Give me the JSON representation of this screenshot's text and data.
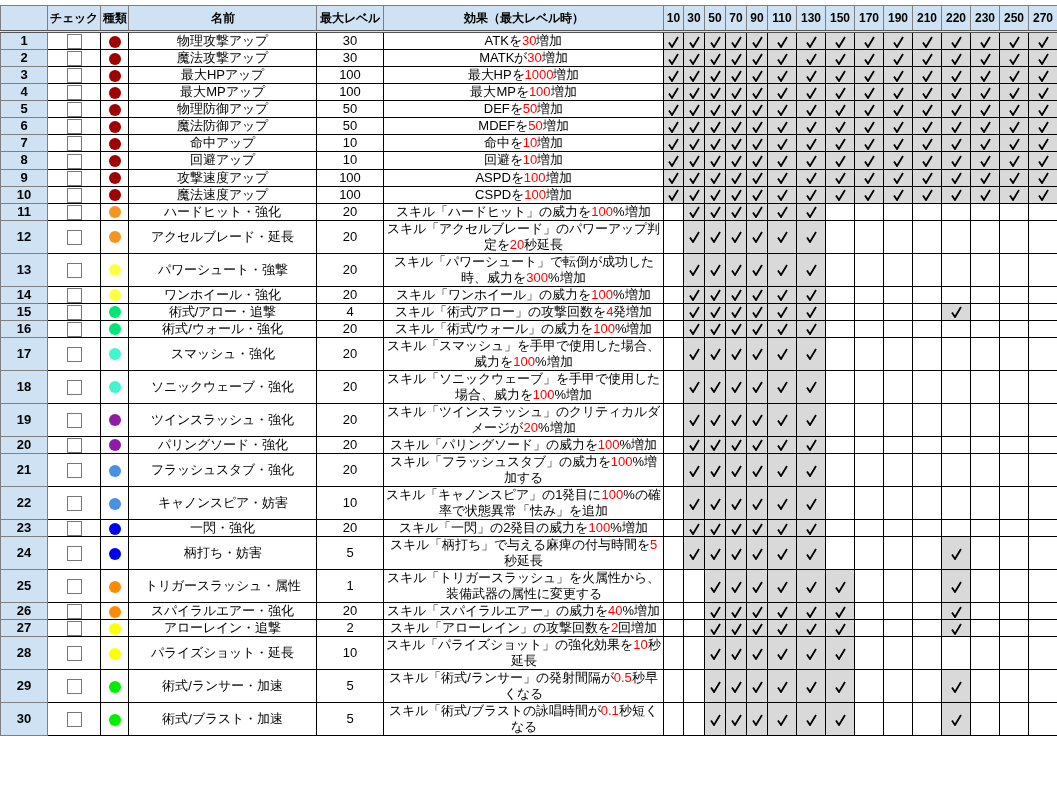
{
  "columns": [
    "チェック",
    "種類",
    "名前",
    "最大レベル",
    "効果（最大レベル時）"
  ],
  "level_columns": [
    "10",
    "30",
    "50",
    "70",
    "90",
    "110",
    "130",
    "150",
    "170",
    "190",
    "210",
    "220",
    "230",
    "250",
    "270"
  ],
  "rows": [
    {
      "no": "1",
      "checked": false,
      "color": "#a00000",
      "name": "物理攻撃アップ",
      "max_level": "30",
      "effect": [
        {
          "text": "ATKを"
        },
        {
          "text": "30",
          "emphasis": true
        },
        {
          "text": "増加"
        }
      ],
      "levels": [
        true,
        true,
        true,
        true,
        true,
        true,
        true,
        true,
        true,
        true,
        true,
        true,
        true,
        true,
        true
      ]
    },
    {
      "no": "2",
      "checked": false,
      "color": "#a00000",
      "name": "魔法攻撃アップ",
      "max_level": "30",
      "effect": [
        {
          "text": "MATKが"
        },
        {
          "text": "30",
          "emphasis": true
        },
        {
          "text": "増加"
        }
      ],
      "levels": [
        true,
        true,
        true,
        true,
        true,
        true,
        true,
        true,
        true,
        true,
        true,
        true,
        true,
        true,
        true
      ]
    },
    {
      "no": "3",
      "checked": false,
      "color": "#a00000",
      "name": "最大HPアップ",
      "max_level": "100",
      "effect": [
        {
          "text": "最大HPを"
        },
        {
          "text": "1000",
          "emphasis": true
        },
        {
          "text": "増加"
        }
      ],
      "levels": [
        true,
        true,
        true,
        true,
        true,
        true,
        true,
        true,
        true,
        true,
        true,
        true,
        true,
        true,
        true
      ]
    },
    {
      "no": "4",
      "checked": false,
      "color": "#a00000",
      "name": "最大MPアップ",
      "max_level": "100",
      "effect": [
        {
          "text": "最大MPを"
        },
        {
          "text": "100",
          "emphasis": true
        },
        {
          "text": "増加"
        }
      ],
      "levels": [
        true,
        true,
        true,
        true,
        true,
        true,
        true,
        true,
        true,
        true,
        true,
        true,
        true,
        true,
        true
      ]
    },
    {
      "no": "5",
      "checked": false,
      "color": "#a00000",
      "name": "物理防御アップ",
      "max_level": "50",
      "effect": [
        {
          "text": "DEFを"
        },
        {
          "text": "50",
          "emphasis": true
        },
        {
          "text": "増加"
        }
      ],
      "levels": [
        true,
        true,
        true,
        true,
        true,
        true,
        true,
        true,
        true,
        true,
        true,
        true,
        true,
        true,
        true
      ]
    },
    {
      "no": "6",
      "checked": false,
      "color": "#a00000",
      "name": "魔法防御アップ",
      "max_level": "50",
      "effect": [
        {
          "text": "MDEFを"
        },
        {
          "text": "50",
          "emphasis": true
        },
        {
          "text": "増加"
        }
      ],
      "levels": [
        true,
        true,
        true,
        true,
        true,
        true,
        true,
        true,
        true,
        true,
        true,
        true,
        true,
        true,
        true
      ]
    },
    {
      "no": "7",
      "checked": false,
      "color": "#a00000",
      "name": "命中アップ",
      "max_level": "10",
      "effect": [
        {
          "text": "命中を"
        },
        {
          "text": "10",
          "emphasis": true
        },
        {
          "text": "増加"
        }
      ],
      "levels": [
        true,
        true,
        true,
        true,
        true,
        true,
        true,
        true,
        true,
        true,
        true,
        true,
        true,
        true,
        true
      ]
    },
    {
      "no": "8",
      "checked": false,
      "color": "#a00000",
      "name": "回避アップ",
      "max_level": "10",
      "effect": [
        {
          "text": "回避を"
        },
        {
          "text": "10",
          "emphasis": true
        },
        {
          "text": "増加"
        }
      ],
      "levels": [
        true,
        true,
        true,
        true,
        true,
        true,
        true,
        true,
        true,
        true,
        true,
        true,
        true,
        true,
        true
      ]
    },
    {
      "no": "9",
      "checked": false,
      "color": "#a00000",
      "name": "攻撃速度アップ",
      "max_level": "100",
      "effect": [
        {
          "text": "ASPDを"
        },
        {
          "text": "100",
          "emphasis": true
        },
        {
          "text": "増加"
        }
      ],
      "levels": [
        true,
        true,
        true,
        true,
        true,
        true,
        true,
        true,
        true,
        true,
        true,
        true,
        true,
        true,
        true
      ]
    },
    {
      "no": "10",
      "checked": false,
      "color": "#a00000",
      "name": "魔法速度アップ",
      "max_level": "100",
      "effect": [
        {
          "text": "CSPDを"
        },
        {
          "text": "100",
          "emphasis": true
        },
        {
          "text": "増加"
        }
      ],
      "levels": [
        true,
        true,
        true,
        true,
        true,
        true,
        true,
        true,
        true,
        true,
        true,
        true,
        true,
        true,
        true
      ]
    },
    {
      "no": "11",
      "checked": false,
      "color": "#f7941d",
      "name": "ハードヒット・強化",
      "max_level": "20",
      "effect": [
        {
          "text": "スキル「ハードヒット」の威力を"
        },
        {
          "text": "100",
          "emphasis": true
        },
        {
          "text": "%増加"
        }
      ],
      "levels": [
        false,
        true,
        true,
        true,
        true,
        true,
        true,
        false,
        false,
        false,
        false,
        false,
        false,
        false,
        false
      ]
    },
    {
      "no": "12",
      "checked": false,
      "color": "#f7941d",
      "name": "アクセルブレード・延長",
      "max_level": "20",
      "effect": [
        {
          "text": "スキル「アクセルブレード」のパワーアップ判定を"
        },
        {
          "text": "20",
          "emphasis": true
        },
        {
          "text": "秒延長"
        }
      ],
      "levels": [
        false,
        true,
        true,
        true,
        true,
        true,
        true,
        false,
        false,
        false,
        false,
        false,
        false,
        false,
        false
      ]
    },
    {
      "no": "13",
      "checked": false,
      "color": "#ffff40",
      "name": "パワーシュート・強撃",
      "max_level": "20",
      "effect": [
        {
          "text": "スキル「パワーシュート」で転倒が成功した時、威力を"
        },
        {
          "text": "300",
          "emphasis": true
        },
        {
          "text": "%増加"
        }
      ],
      "levels": [
        false,
        true,
        true,
        true,
        true,
        true,
        true,
        false,
        false,
        false,
        false,
        false,
        false,
        false,
        false
      ]
    },
    {
      "no": "14",
      "checked": false,
      "color": "#ffff40",
      "name": "ワンホイール・強化",
      "max_level": "20",
      "effect": [
        {
          "text": "スキル「ワンホイール」の威力を"
        },
        {
          "text": "100",
          "emphasis": true
        },
        {
          "text": "%増加"
        }
      ],
      "levels": [
        false,
        true,
        true,
        true,
        true,
        true,
        true,
        false,
        false,
        false,
        false,
        false,
        false,
        false,
        false
      ]
    },
    {
      "no": "15",
      "checked": false,
      "color": "#00e676",
      "name": "術式/アロー・追撃",
      "max_level": "4",
      "effect": [
        {
          "text": "スキル「術式/アロー」の攻撃回数を"
        },
        {
          "text": "4",
          "emphasis": true
        },
        {
          "text": "発増加"
        }
      ],
      "levels": [
        false,
        true,
        true,
        true,
        true,
        true,
        true,
        false,
        false,
        false,
        false,
        true,
        false,
        false,
        false
      ]
    },
    {
      "no": "16",
      "checked": false,
      "color": "#00e676",
      "name": "術式/ウォール・強化",
      "max_level": "20",
      "effect": [
        {
          "text": "スキル「術式/ウォール」の威力を"
        },
        {
          "text": "100",
          "emphasis": true
        },
        {
          "text": "%増加"
        }
      ],
      "levels": [
        false,
        true,
        true,
        true,
        true,
        true,
        true,
        false,
        false,
        false,
        false,
        false,
        false,
        false,
        false
      ]
    },
    {
      "no": "17",
      "checked": false,
      "color": "#40f5d0",
      "name": "スマッシュ・強化",
      "max_level": "20",
      "effect": [
        {
          "text": "スキル「スマッシュ」を手甲で使用した場合、威力を"
        },
        {
          "text": "100",
          "emphasis": true
        },
        {
          "text": "%増加"
        }
      ],
      "levels": [
        false,
        true,
        true,
        true,
        true,
        true,
        true,
        false,
        false,
        false,
        false,
        false,
        false,
        false,
        false
      ]
    },
    {
      "no": "18",
      "checked": false,
      "color": "#40f5d0",
      "name": "ソニックウェーブ・強化",
      "max_level": "20",
      "effect": [
        {
          "text": "スキル「ソニックウェーブ」を手甲で使用した場合、威力を"
        },
        {
          "text": "100",
          "emphasis": true
        },
        {
          "text": "%増加"
        }
      ],
      "levels": [
        false,
        true,
        true,
        true,
        true,
        true,
        true,
        false,
        false,
        false,
        false,
        false,
        false,
        false,
        false
      ]
    },
    {
      "no": "19",
      "checked": false,
      "color": "#8e1aa8",
      "name": "ツインスラッシュ・強化",
      "max_level": "20",
      "effect": [
        {
          "text": "スキル「ツインスラッシュ」のクリティカルダメージが"
        },
        {
          "text": "20",
          "emphasis": true
        },
        {
          "text": "%増加"
        }
      ],
      "levels": [
        false,
        true,
        true,
        true,
        true,
        true,
        true,
        false,
        false,
        false,
        false,
        false,
        false,
        false,
        false
      ]
    },
    {
      "no": "20",
      "checked": false,
      "color": "#8e1aa8",
      "name": "パリングソード・強化",
      "max_level": "20",
      "effect": [
        {
          "text": "スキル「パリングソード」の威力を"
        },
        {
          "text": "100",
          "emphasis": true
        },
        {
          "text": "%増加"
        }
      ],
      "levels": [
        false,
        true,
        true,
        true,
        true,
        true,
        true,
        false,
        false,
        false,
        false,
        false,
        false,
        false,
        false
      ]
    },
    {
      "no": "21",
      "checked": false,
      "color": "#4a90e2",
      "name": "フラッシュスタブ・強化",
      "max_level": "20",
      "effect": [
        {
          "text": "スキル「フラッシュスタブ」の威力を"
        },
        {
          "text": "100",
          "emphasis": true
        },
        {
          "text": "%増加する"
        }
      ],
      "levels": [
        false,
        true,
        true,
        true,
        true,
        true,
        true,
        false,
        false,
        false,
        false,
        false,
        false,
        false,
        false
      ]
    },
    {
      "no": "22",
      "checked": false,
      "color": "#4a90e2",
      "name": "キャノンスピア・妨害",
      "max_level": "10",
      "effect": [
        {
          "text": "スキル「キャノンスピア」の1発目に"
        },
        {
          "text": "100",
          "emphasis": true
        },
        {
          "text": "%の確率で状態異常「怯み」を追加"
        }
      ],
      "levels": [
        false,
        true,
        true,
        true,
        true,
        true,
        true,
        false,
        false,
        false,
        false,
        false,
        false,
        false,
        false
      ]
    },
    {
      "no": "23",
      "checked": false,
      "color": "#0000f0",
      "name": "一閃・強化",
      "max_level": "20",
      "effect": [
        {
          "text": "スキル「一閃」の2発目の威力を"
        },
        {
          "text": "100",
          "emphasis": true
        },
        {
          "text": "%増加"
        }
      ],
      "levels": [
        false,
        true,
        true,
        true,
        true,
        true,
        true,
        false,
        false,
        false,
        false,
        false,
        false,
        false,
        false
      ]
    },
    {
      "no": "24",
      "checked": false,
      "color": "#0000f0",
      "name": "柄打ち・妨害",
      "max_level": "5",
      "effect": [
        {
          "text": "スキル「柄打ち」で与える麻痺の付与時間を"
        },
        {
          "text": "5",
          "emphasis": true
        },
        {
          "text": "秒延長"
        }
      ],
      "levels": [
        false,
        true,
        true,
        true,
        true,
        true,
        true,
        false,
        false,
        false,
        false,
        true,
        false,
        false,
        false
      ]
    },
    {
      "no": "25",
      "checked": false,
      "color": "#ff8c00",
      "name": "トリガースラッシュ・属性",
      "max_level": "1",
      "effect": [
        {
          "text": "スキル「トリガースラッシュ」を火属性から、装備武器の属性に変更する"
        }
      ],
      "levels": [
        false,
        false,
        true,
        true,
        true,
        true,
        true,
        true,
        false,
        false,
        false,
        true,
        false,
        false,
        false
      ]
    },
    {
      "no": "26",
      "checked": false,
      "color": "#ff8c00",
      "name": "スパイラルエアー・強化",
      "max_level": "20",
      "effect": [
        {
          "text": "スキル「スパイラルエアー」の威力を"
        },
        {
          "text": "40",
          "emphasis": true
        },
        {
          "text": "%増加"
        }
      ],
      "levels": [
        false,
        false,
        true,
        true,
        true,
        true,
        true,
        true,
        false,
        false,
        false,
        true,
        false,
        false,
        false
      ]
    },
    {
      "no": "27",
      "checked": false,
      "color": "#ffff00",
      "name": "アローレイン・追撃",
      "max_level": "2",
      "effect": [
        {
          "text": "スキル「アローレイン」の攻撃回数を"
        },
        {
          "text": "2",
          "emphasis": true
        },
        {
          "text": "回増加"
        }
      ],
      "levels": [
        false,
        false,
        true,
        true,
        true,
        true,
        true,
        true,
        false,
        false,
        false,
        true,
        false,
        false,
        false
      ]
    },
    {
      "no": "28",
      "checked": false,
      "color": "#ffff00",
      "name": "パライズショット・延長",
      "max_level": "10",
      "effect": [
        {
          "text": "スキル「パライズショット」の強化効果を"
        },
        {
          "text": "10",
          "emphasis": true
        },
        {
          "text": "秒延長"
        }
      ],
      "levels": [
        false,
        false,
        true,
        true,
        true,
        true,
        true,
        true,
        false,
        false,
        false,
        false,
        false,
        false,
        false
      ]
    },
    {
      "no": "29",
      "checked": false,
      "color": "#00ee00",
      "name": "術式/ランサー・加速",
      "max_level": "5",
      "effect": [
        {
          "text": "スキル「術式/ランサー」の発射間隔が"
        },
        {
          "text": "0.5",
          "emphasis": true
        },
        {
          "text": "秒早くなる"
        }
      ],
      "levels": [
        false,
        false,
        true,
        true,
        true,
        true,
        true,
        true,
        false,
        false,
        false,
        true,
        false,
        false,
        false
      ]
    },
    {
      "no": "30",
      "checked": false,
      "color": "#00ee00",
      "name": "術式/ブラスト・加速",
      "max_level": "5",
      "effect": [
        {
          "text": "スキル「術式/ブラストの詠唱時間が"
        },
        {
          "text": "0.1",
          "emphasis": true
        },
        {
          "text": "秒短くなる"
        }
      ],
      "levels": [
        false,
        false,
        true,
        true,
        true,
        true,
        true,
        true,
        false,
        false,
        false,
        true,
        false,
        false,
        false
      ]
    }
  ]
}
